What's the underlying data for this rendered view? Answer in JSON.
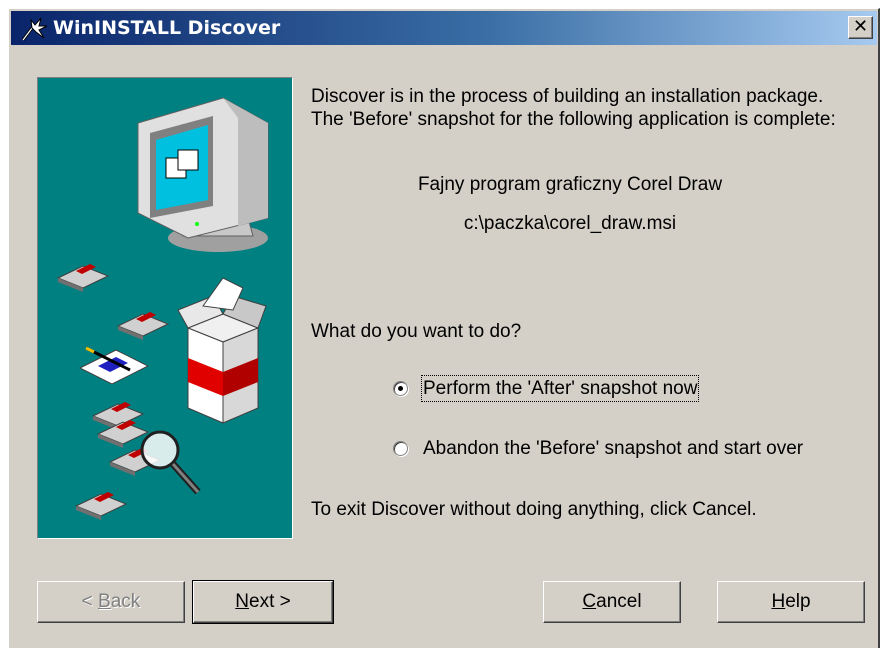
{
  "window": {
    "title": "WinINSTALL Discover",
    "close_glyph": "✕"
  },
  "content": {
    "intro": "Discover is in the process of building an installation package.  The 'Before' snapshot for the following application is complete:",
    "app_name": "Fajny program graficzny Corel Draw",
    "package_path": "c:\\paczka\\corel_draw.msi",
    "question": "What do you want to do?",
    "exit_hint": "To exit Discover without doing anything, click Cancel."
  },
  "options": [
    {
      "label": "Perform the 'After' snapshot now",
      "selected": true
    },
    {
      "label": "Abandon the 'Before' snapshot and start over",
      "selected": false
    }
  ],
  "buttons": {
    "back": {
      "pre": "< ",
      "key": "B",
      "post": "ack",
      "enabled": false
    },
    "next": {
      "pre": "",
      "key": "N",
      "post": "ext >",
      "enabled": true
    },
    "cancel": {
      "pre": "",
      "key": "C",
      "post": "ancel",
      "enabled": true
    },
    "help": {
      "pre": "",
      "key": "H",
      "post": "elp",
      "enabled": true
    }
  },
  "colors": {
    "title_gradient_start": "#0a246a",
    "title_gradient_end": "#a6caf0",
    "dialog_face": "#d4d0c8",
    "art_background": "#008080"
  },
  "icons": [
    "wizard-title-icon",
    "close-icon",
    "computer-monitor-illustration",
    "floppy-disk-icon",
    "package-box-illustration",
    "magnifier-icon",
    "notepad-pencil-icon"
  ]
}
